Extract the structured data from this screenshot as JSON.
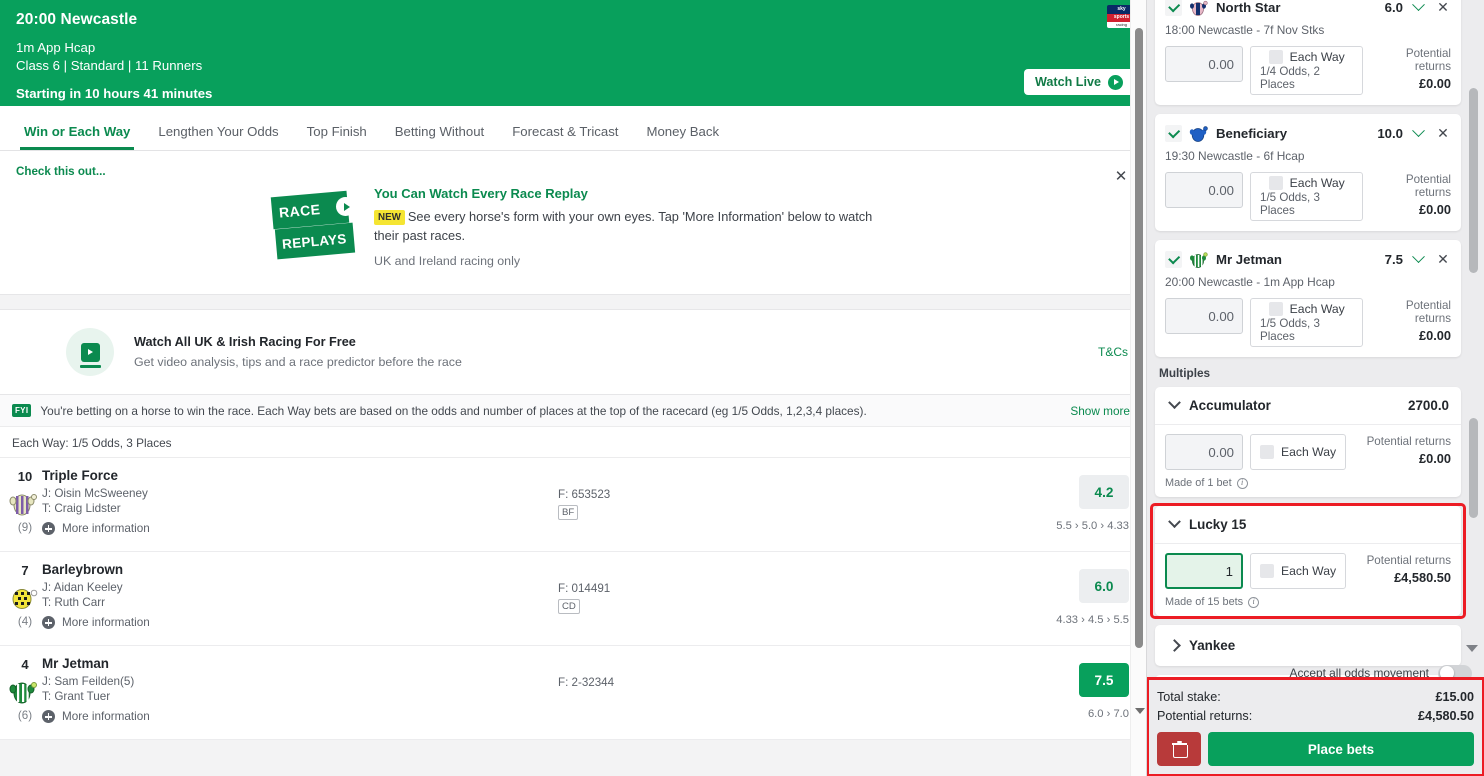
{
  "race_header": {
    "title": "20:00 Newcastle",
    "distance": "1m App Hcap",
    "details": "Class 6 | Standard | 11 Runners",
    "starting": "Starting in 10 hours 41 minutes",
    "watch_live": "Watch Live",
    "logo_line1": "sky",
    "logo_line2": "sports",
    "logo_line3": "racing",
    "accent": "#08a05c"
  },
  "tabs": [
    {
      "label": "Win or Each Way",
      "active": true
    },
    {
      "label": "Lengthen Your Odds",
      "active": false
    },
    {
      "label": "Top Finish",
      "active": false
    },
    {
      "label": "Betting Without",
      "active": false
    },
    {
      "label": "Forecast & Tricast",
      "active": false
    },
    {
      "label": "Money Back",
      "active": false
    }
  ],
  "promo": {
    "eyebrow": "Check this out...",
    "badge_top": "RACE",
    "badge_bottom": "REPLAYS",
    "title": "You Can Watch Every Race Replay",
    "new_tag": "NEW",
    "description": "See every horse's form with your own eyes. Tap 'More Information' below to watch their past races.",
    "note": "UK and Ireland racing only"
  },
  "watch_free": {
    "title": "Watch All UK & Irish Racing For Free",
    "subtitle": "Get video analysis, tips and a race predictor before the race",
    "tcs": "T&Cs"
  },
  "fyi": {
    "chip": "FYI",
    "text": "You're betting on a horse to win the race. Each Way bets are based on the odds and number of places at the top of the racecard (eg 1/5 Odds, 1,2,3,4 places).",
    "show_more": "Show more"
  },
  "each_way_bar": "Each Way: 1/5 Odds, 3 Places",
  "runners": [
    {
      "number": "10",
      "draw": "(9)",
      "name": "Triple Force",
      "jockey": "J: Oisin McSweeney",
      "trainer": "T: Craig Lidster",
      "more_info": "More information",
      "form": "F: 653523",
      "tag": "BF",
      "odds": "4.2",
      "selected": false,
      "odds_history": "5.5 › 5.0 › 4.33"
    },
    {
      "number": "7",
      "draw": "(4)",
      "name": "Barleybrown",
      "jockey": "J: Aidan Keeley",
      "trainer": "T: Ruth Carr",
      "more_info": "More information",
      "form": "F: 014491",
      "tag": "CD",
      "odds": "6.0",
      "selected": false,
      "odds_history": "4.33 › 4.5 › 5.5"
    },
    {
      "number": "4",
      "draw": "(6)",
      "name": "Mr Jetman",
      "jockey": "J: Sam Feilden(5)",
      "trainer": "T: Grant Tuer",
      "more_info": "More information",
      "form": "F: 2-32344",
      "tag": "",
      "odds": "7.5",
      "selected": true,
      "odds_history": "6.0 › 7.0"
    }
  ],
  "betslip": {
    "selections": [
      {
        "name": "North Star",
        "odds": "6.0",
        "meta": "18:00 Newcastle - 7f Nov Stks",
        "stake": "0.00",
        "ew_label": "Each Way",
        "ew_sub": "1/4 Odds, 2 Places",
        "returns_label": "Potential returns",
        "returns_value": "£0.00"
      },
      {
        "name": "Beneficiary",
        "odds": "10.0",
        "meta": "19:30 Newcastle - 6f Hcap",
        "stake": "0.00",
        "ew_label": "Each Way",
        "ew_sub": "1/5 Odds, 3 Places",
        "returns_label": "Potential returns",
        "returns_value": "£0.00"
      },
      {
        "name": "Mr Jetman",
        "odds": "7.5",
        "meta": "20:00 Newcastle - 1m App Hcap",
        "stake": "0.00",
        "ew_label": "Each Way",
        "ew_sub": "1/5 Odds, 3 Places",
        "returns_label": "Potential returns",
        "returns_value": "£0.00"
      }
    ],
    "multiples_header": "Multiples",
    "multiples": [
      {
        "name": "Accumulator",
        "odds": "2700.0",
        "expanded": true,
        "stake": "0.00",
        "stake_focused": false,
        "ew_label": "Each Way",
        "returns_label": "Potential returns",
        "returns_value": "£0.00",
        "made_of": "Made of 1 bet",
        "highlighted": false
      },
      {
        "name": "Lucky 15",
        "odds": "",
        "expanded": true,
        "stake": "1",
        "stake_focused": true,
        "ew_label": "Each Way",
        "returns_label": "Potential returns",
        "returns_value": "£4,580.50",
        "made_of": "Made of 15 bets",
        "highlighted": true
      },
      {
        "name": "Yankee",
        "odds": "",
        "expanded": false,
        "highlighted": false
      }
    ],
    "odds_movement_label": "Accept all odds movement",
    "total_stake_label": "Total stake:",
    "total_stake_value": "£15.00",
    "potential_returns_label": "Potential returns:",
    "potential_returns_value": "£4,580.50",
    "place_bets_label": "Place bets",
    "highlight_color": "#ec1c24"
  }
}
